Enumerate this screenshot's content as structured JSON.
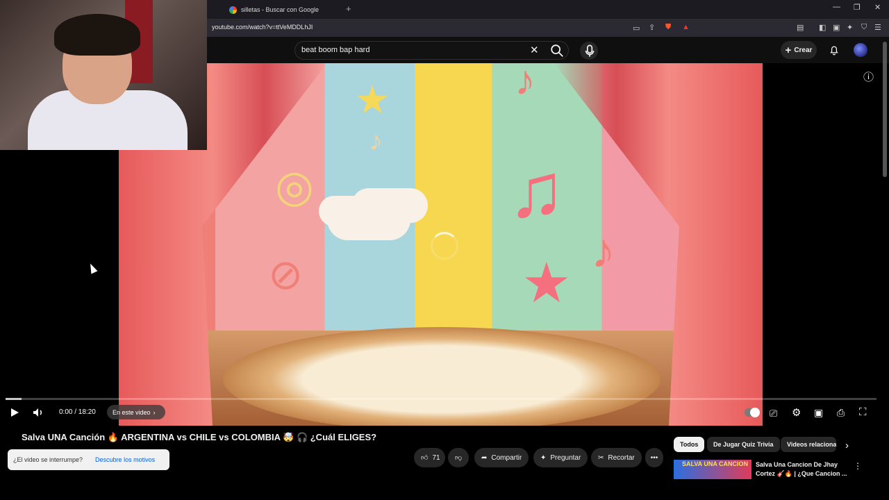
{
  "browser": {
    "tab_title": "silletas - Buscar con Google",
    "new_tab_symbol": "+",
    "url": "youtube.com/watch?v=ttVeMDDLhJI",
    "window_controls": [
      "—",
      "❐",
      "✕"
    ]
  },
  "youtube": {
    "search_value": "beat boom bap hard",
    "create_label": "Crear"
  },
  "player": {
    "current_time": "0:00",
    "duration": "18:20",
    "time_display": "0:00 / 18:20",
    "chapter_label": "En este video",
    "progress_fraction": 0.018,
    "autoplay_on": true
  },
  "video": {
    "title": "Salva UNA Canción 🔥 ARGENTINA vs CHILE vs COLOMBIA 🤯 🎧 ¿Cuál ELIGES?",
    "like_count": "71",
    "actions": {
      "share": "Compartir",
      "ask": "Preguntar",
      "clip": "Recortar"
    }
  },
  "toast": {
    "question": "¿El video se interrumpe?",
    "link": "Descubre los motivos"
  },
  "chips": [
    "Todos",
    "De Jugar Quiz Trivia",
    "Videos relacionad"
  ],
  "related": {
    "thumb_text": "SALVA UNA CANCION",
    "title": "Salva Una Cancion De Jhay Cortez 🎸🔥 | ¿Que Cancion ..."
  },
  "colors": {
    "accent": "#065fd4",
    "background": "#0f0f0f",
    "pill": "#272727"
  }
}
